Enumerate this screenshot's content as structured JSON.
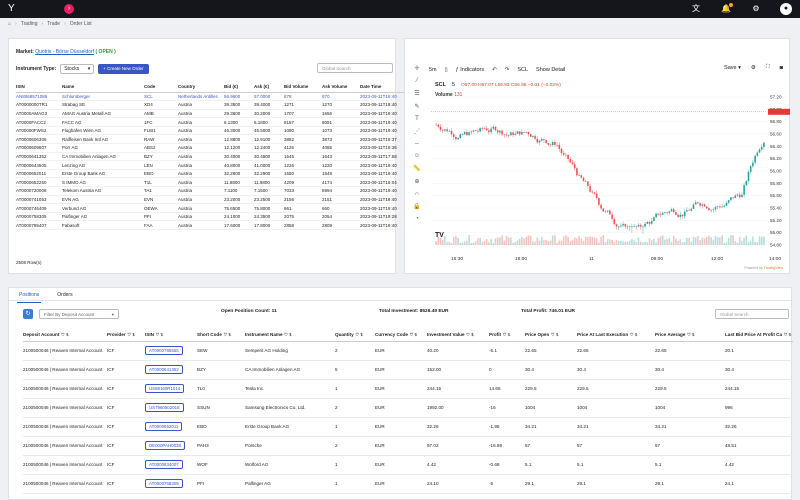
{
  "topbar": {
    "logo": "Y",
    "expand": "›",
    "icons": [
      "translate-icon",
      "bell-icon",
      "gear-icon",
      "user-icon"
    ]
  },
  "breadcrumb": {
    "home": "⌂",
    "items": [
      "Trading",
      "Trade",
      "Order List"
    ]
  },
  "order_panel": {
    "market_label": "Market:",
    "market_value": "Quotrix - Börse Düsseldorf",
    "market_status": "( OPEN )",
    "instrument_type_label": "Instrument Type:",
    "instrument_type_value": "Stocks",
    "create_button": "+ Create New Order",
    "search_placeholder": "Global Search",
    "columns": [
      "ISIN",
      "Name",
      "Code",
      "Country",
      "Bid (€)",
      "Ask (€)",
      "Bid Volume",
      "Ask Volume",
      "Date Time"
    ],
    "rows": [
      [
        "AN8068571086",
        "Schlumberger",
        "SCL",
        "Netherlands Antilles",
        "56.9600",
        "57.0000",
        "878",
        "870",
        "2023-09-11T19:40"
      ],
      [
        "AT0000000TR1",
        "Strabag SE",
        "XD4",
        "Austria",
        "39.3500",
        "39.4000",
        "1271",
        "1270",
        "2023-09-11T19:40"
      ],
      [
        "AT0000AMAG3",
        "AMAG Austria Metall AG",
        "AMB",
        "Austria",
        "29.3500",
        "30.2000",
        "1707",
        "1656",
        "2023-09-11T19:40"
      ],
      [
        "AT0000FACC2",
        "FACC AG",
        "1FC",
        "Austria",
        "6.1300",
        "6.1800",
        "8157",
        "8091",
        "2023-09-11T19:40"
      ],
      [
        "AT00000FWS2",
        "Flughafen Wien AG",
        "FLW1",
        "Austria",
        "46.3000",
        "46.5000",
        "1080",
        "1073",
        "2023-09-11T19:40"
      ],
      [
        "AT0000606306",
        "Raiffeisen Bank Intl AG",
        "RAW",
        "Austria",
        "12.8800",
        "12.9100",
        "3882",
        "3873",
        "2023-09-11T19:37"
      ],
      [
        "AT0000609607",
        "Porr AG",
        "ABS2",
        "Austria",
        "12.1200",
        "12.2400",
        "4126",
        "4085",
        "2023-09-11T19:36"
      ],
      [
        "AT0000641352",
        "CA Immobilien Anlagen AG",
        "BZY",
        "Austria",
        "30.4000",
        "30.4500",
        "1645",
        "1643",
        "2023-09-11T17:58"
      ],
      [
        "AT0000644505",
        "Lenzing AG",
        "LEN",
        "Austria",
        "40.8000",
        "41.0000",
        "1226",
        "1220",
        "2023-09-11T19:40"
      ],
      [
        "AT0000652011",
        "Erste Group Bank AG",
        "EBO",
        "Austria",
        "32.2600",
        "32.2900",
        "1550",
        "1549",
        "2023-09-11T19:40"
      ],
      [
        "AT0000652250",
        "S IMMO AG",
        "T1L",
        "Austria",
        "11.8800",
        "11.9800",
        "4209",
        "4174",
        "2023-09-11T16:04"
      ],
      [
        "AT0000720008",
        "Telekom Austria AG",
        "TA1",
        "Austria",
        "7.1100",
        "7.1500",
        "7033",
        "6994",
        "2023-09-11T19:40"
      ],
      [
        "AT0000741053",
        "EVN AG",
        "EVN",
        "Austria",
        "23.2000",
        "23.2500",
        "2156",
        "2151",
        "2023-09-11T19:40"
      ],
      [
        "AT0000746409",
        "Verbund AG",
        "OEWA",
        "Austria",
        "75.6500",
        "75.8000",
        "661",
        "660",
        "2023-09-11T19:40"
      ],
      [
        "AT0000758305",
        "Palfinger AG",
        "PFI",
        "Austria",
        "24.1000",
        "24.3500",
        "2075",
        "2054",
        "2023-09-11T19:28"
      ],
      [
        "AT0000785407",
        "Fabasoft",
        "FAA",
        "Austria",
        "17.6000",
        "17.8000",
        "2858",
        "2809",
        "2023-09-11T19:40"
      ]
    ],
    "row_count": "2508 Row(s)"
  },
  "chart_panel": {
    "interval": "5m",
    "indicators": "Indicators",
    "symbol_btn": "SCL",
    "show_detail": "Show Detail",
    "save": "Save",
    "symbol": "SCL",
    "sym_interval": "5",
    "ohlc": "O57.00 H57.07 L56.93 C56.96 −0.01 (−0.02%)",
    "volume_label": "Volume",
    "volume_value": "131",
    "tv_logo": "TV",
    "powered_by": "Powered by",
    "powered_brand": "TradingView",
    "y_ticks": [
      "57.20",
      "57.00",
      "56.80",
      "56.60",
      "56.40",
      "56.20",
      "56.00",
      "55.80",
      "55.60",
      "55.40",
      "55.20",
      "55.00",
      "54.80"
    ],
    "x_ticks": [
      "16:30",
      "18:00",
      "11",
      "09:00",
      "12:00",
      "14:00"
    ],
    "accent": "#e53935",
    "up_color": "#26a69a",
    "down_color": "#ef5350"
  },
  "bottom_panel": {
    "tabs": [
      "Positions",
      "Orders"
    ],
    "filter_placeholder": "Filter By Deposit Account",
    "open_position_count": "Open Position Count: 11",
    "total_investment": "Total Investment: 8526.49 EUR",
    "total_profit": "Total Profit: 746.01 EUR",
    "search_placeholder": "Global Search",
    "columns": [
      "Deposit Account",
      "Provider",
      "ISIN",
      "Short Code",
      "Instrument Name",
      "Quantity",
      "Currency Code",
      "Investment Value",
      "Profit",
      "Price Open",
      "Price At Last Execution",
      "Price Average",
      "Last Bid Price At Profit Ca"
    ],
    "rows": [
      [
        "2100500046 | Reaven Internal Account",
        "ICF",
        "AT0000785555",
        "SEW",
        "Semperit AG Holding",
        "2",
        "EUR",
        "40.20",
        "-5.1",
        "22.65",
        "22.65",
        "22.65",
        "20.1"
      ],
      [
        "2100500046 | Reaven Internal Account",
        "ICF",
        "AT0000641352",
        "BZY",
        "CA Immobilien Anlagen AG",
        "5",
        "EUR",
        "152.00",
        "0",
        "30.4",
        "30.4",
        "30.4",
        "30.4"
      ],
      [
        "2100500046 | Reaven Internal Account",
        "ICF",
        "US88160R1014",
        "TL0",
        "Tesla Inc.",
        "1",
        "EUR",
        "244.15",
        "14.65",
        "229.5",
        "229.5",
        "229.5",
        "244.15"
      ],
      [
        "2100500046 | Reaven Internal Account",
        "ICF",
        "US7960502018",
        "SSUN",
        "Samsung Electronics Co. Ltd.",
        "2",
        "EUR",
        "1992.00",
        "-16",
        "1004",
        "1004",
        "1004",
        "996"
      ],
      [
        "2100500046 | Reaven Internal Account",
        "ICF",
        "AT0000652011",
        "EBO",
        "Erste Group Bank AG",
        "1",
        "EUR",
        "32.26",
        "-1.95",
        "34.21",
        "34.21",
        "34.21",
        "32.26"
      ],
      [
        "2100500046 | Reaven Internal Account",
        "ICF",
        "DE000PAH0038",
        "PAH3",
        "Porsche",
        "2",
        "EUR",
        "97.02",
        "-16.98",
        "57",
        "57",
        "57",
        "48.51"
      ],
      [
        "2100500046 | Reaven Internal Account",
        "ICF",
        "AT0000834007",
        "WOF",
        "Wolford AG",
        "1",
        "EUR",
        "4.42",
        "-0.68",
        "5.1",
        "5.1",
        "5.1",
        "4.42"
      ],
      [
        "2100500046 | Reaven Internal Account",
        "ICF",
        "AT0000758305",
        "PFI",
        "Palfinger AG",
        "1",
        "EUR",
        "24.10",
        "-5",
        "29.1",
        "29.1",
        "29.1",
        "24.1"
      ]
    ]
  }
}
